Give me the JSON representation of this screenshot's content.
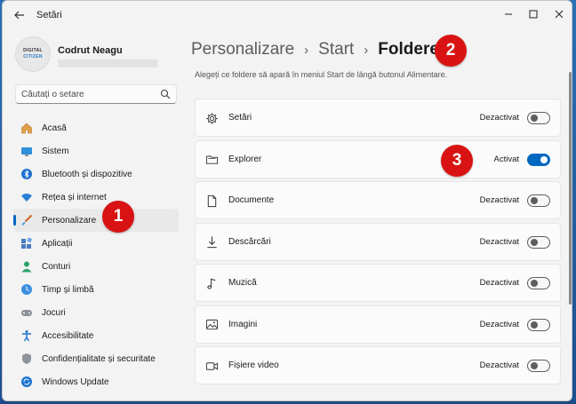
{
  "window": {
    "title": "Setări"
  },
  "profile": {
    "name": "Codrut Neagu",
    "avatar_line1": "DIGITAL",
    "avatar_line2": "CITIZEN"
  },
  "search": {
    "placeholder": "Căutați o setare"
  },
  "nav": {
    "items": [
      {
        "label": "Acasă",
        "icon": "home-icon",
        "selected": false
      },
      {
        "label": "Sistem",
        "icon": "monitor-icon",
        "selected": false
      },
      {
        "label": "Bluetooth și dispozitive",
        "icon": "bluetooth-icon",
        "selected": false
      },
      {
        "label": "Rețea și internet",
        "icon": "wifi-icon",
        "selected": false
      },
      {
        "label": "Personalizare",
        "icon": "brush-icon",
        "selected": true
      },
      {
        "label": "Aplicații",
        "icon": "apps-icon",
        "selected": false
      },
      {
        "label": "Conturi",
        "icon": "person-icon",
        "selected": false
      },
      {
        "label": "Timp și limbă",
        "icon": "clock-globe-icon",
        "selected": false
      },
      {
        "label": "Jocuri",
        "icon": "gamepad-icon",
        "selected": false
      },
      {
        "label": "Accesibilitate",
        "icon": "accessibility-icon",
        "selected": false
      },
      {
        "label": "Confidențialitate și securitate",
        "icon": "shield-icon",
        "selected": false
      },
      {
        "label": "Windows Update",
        "icon": "update-icon",
        "selected": false
      }
    ]
  },
  "breadcrumb": {
    "items": [
      "Personalizare",
      "Start",
      "Foldere"
    ],
    "separator": "›"
  },
  "subtitle": "Alegeți ce foldere să apară în meniul Start de lângă butonul Alimentare.",
  "folders": [
    {
      "label": "Setări",
      "icon": "gear-icon",
      "status": "Dezactivat",
      "on": false
    },
    {
      "label": "Explorer",
      "icon": "folder-icon",
      "status": "Activat",
      "on": true
    },
    {
      "label": "Documente",
      "icon": "document-icon",
      "status": "Dezactivat",
      "on": false
    },
    {
      "label": "Descărcări",
      "icon": "download-icon",
      "status": "Dezactivat",
      "on": false
    },
    {
      "label": "Muzică",
      "icon": "music-icon",
      "status": "Dezactivat",
      "on": false
    },
    {
      "label": "Imagini",
      "icon": "image-icon",
      "status": "Dezactivat",
      "on": false
    },
    {
      "label": "Fișiere video",
      "icon": "video-icon",
      "status": "Dezactivat",
      "on": false
    }
  ],
  "markers": [
    "1",
    "2",
    "3"
  ],
  "colors": {
    "accent": "#0067c0",
    "marker": "#d91313"
  }
}
